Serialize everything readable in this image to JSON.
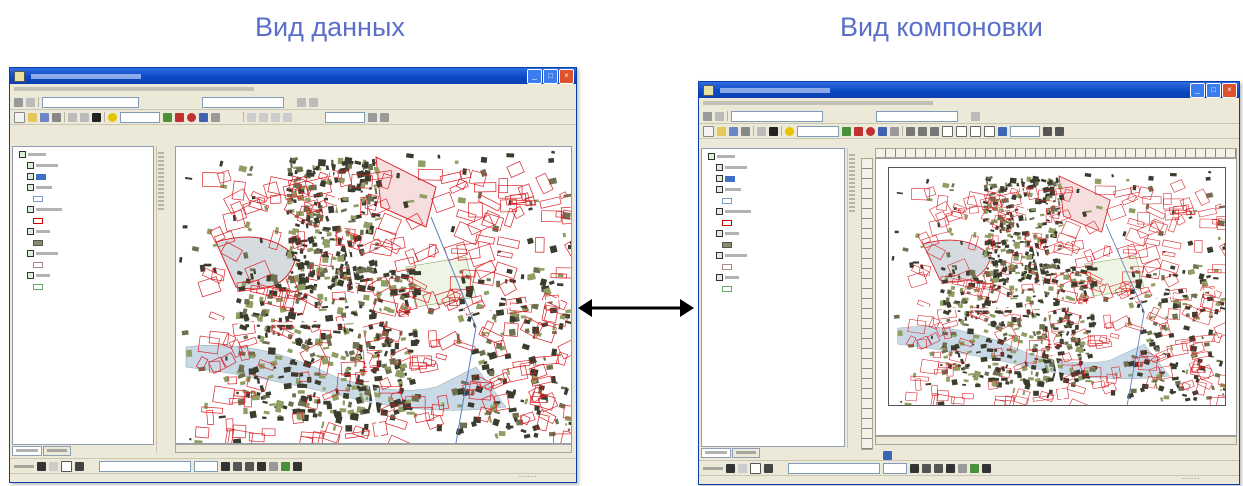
{
  "captions": {
    "left": "Вид данных",
    "right": "Вид компоновки"
  },
  "colors": {
    "caption": "#5a6fc9",
    "titlebar": "#0a47c4",
    "parcel_red": "#d9242a",
    "building_dark": "#3b3b2e",
    "building_green": "#8f9e62",
    "water": "#c9d9e6"
  },
  "icons": [
    "app-icon",
    "minimize-icon",
    "maximize-icon",
    "close-icon",
    "double-arrow-icon",
    "layer-checkbox-icon"
  ],
  "left_window": {
    "status": "- - - - - -"
  },
  "right_window": {
    "status": "- - - - - -"
  }
}
